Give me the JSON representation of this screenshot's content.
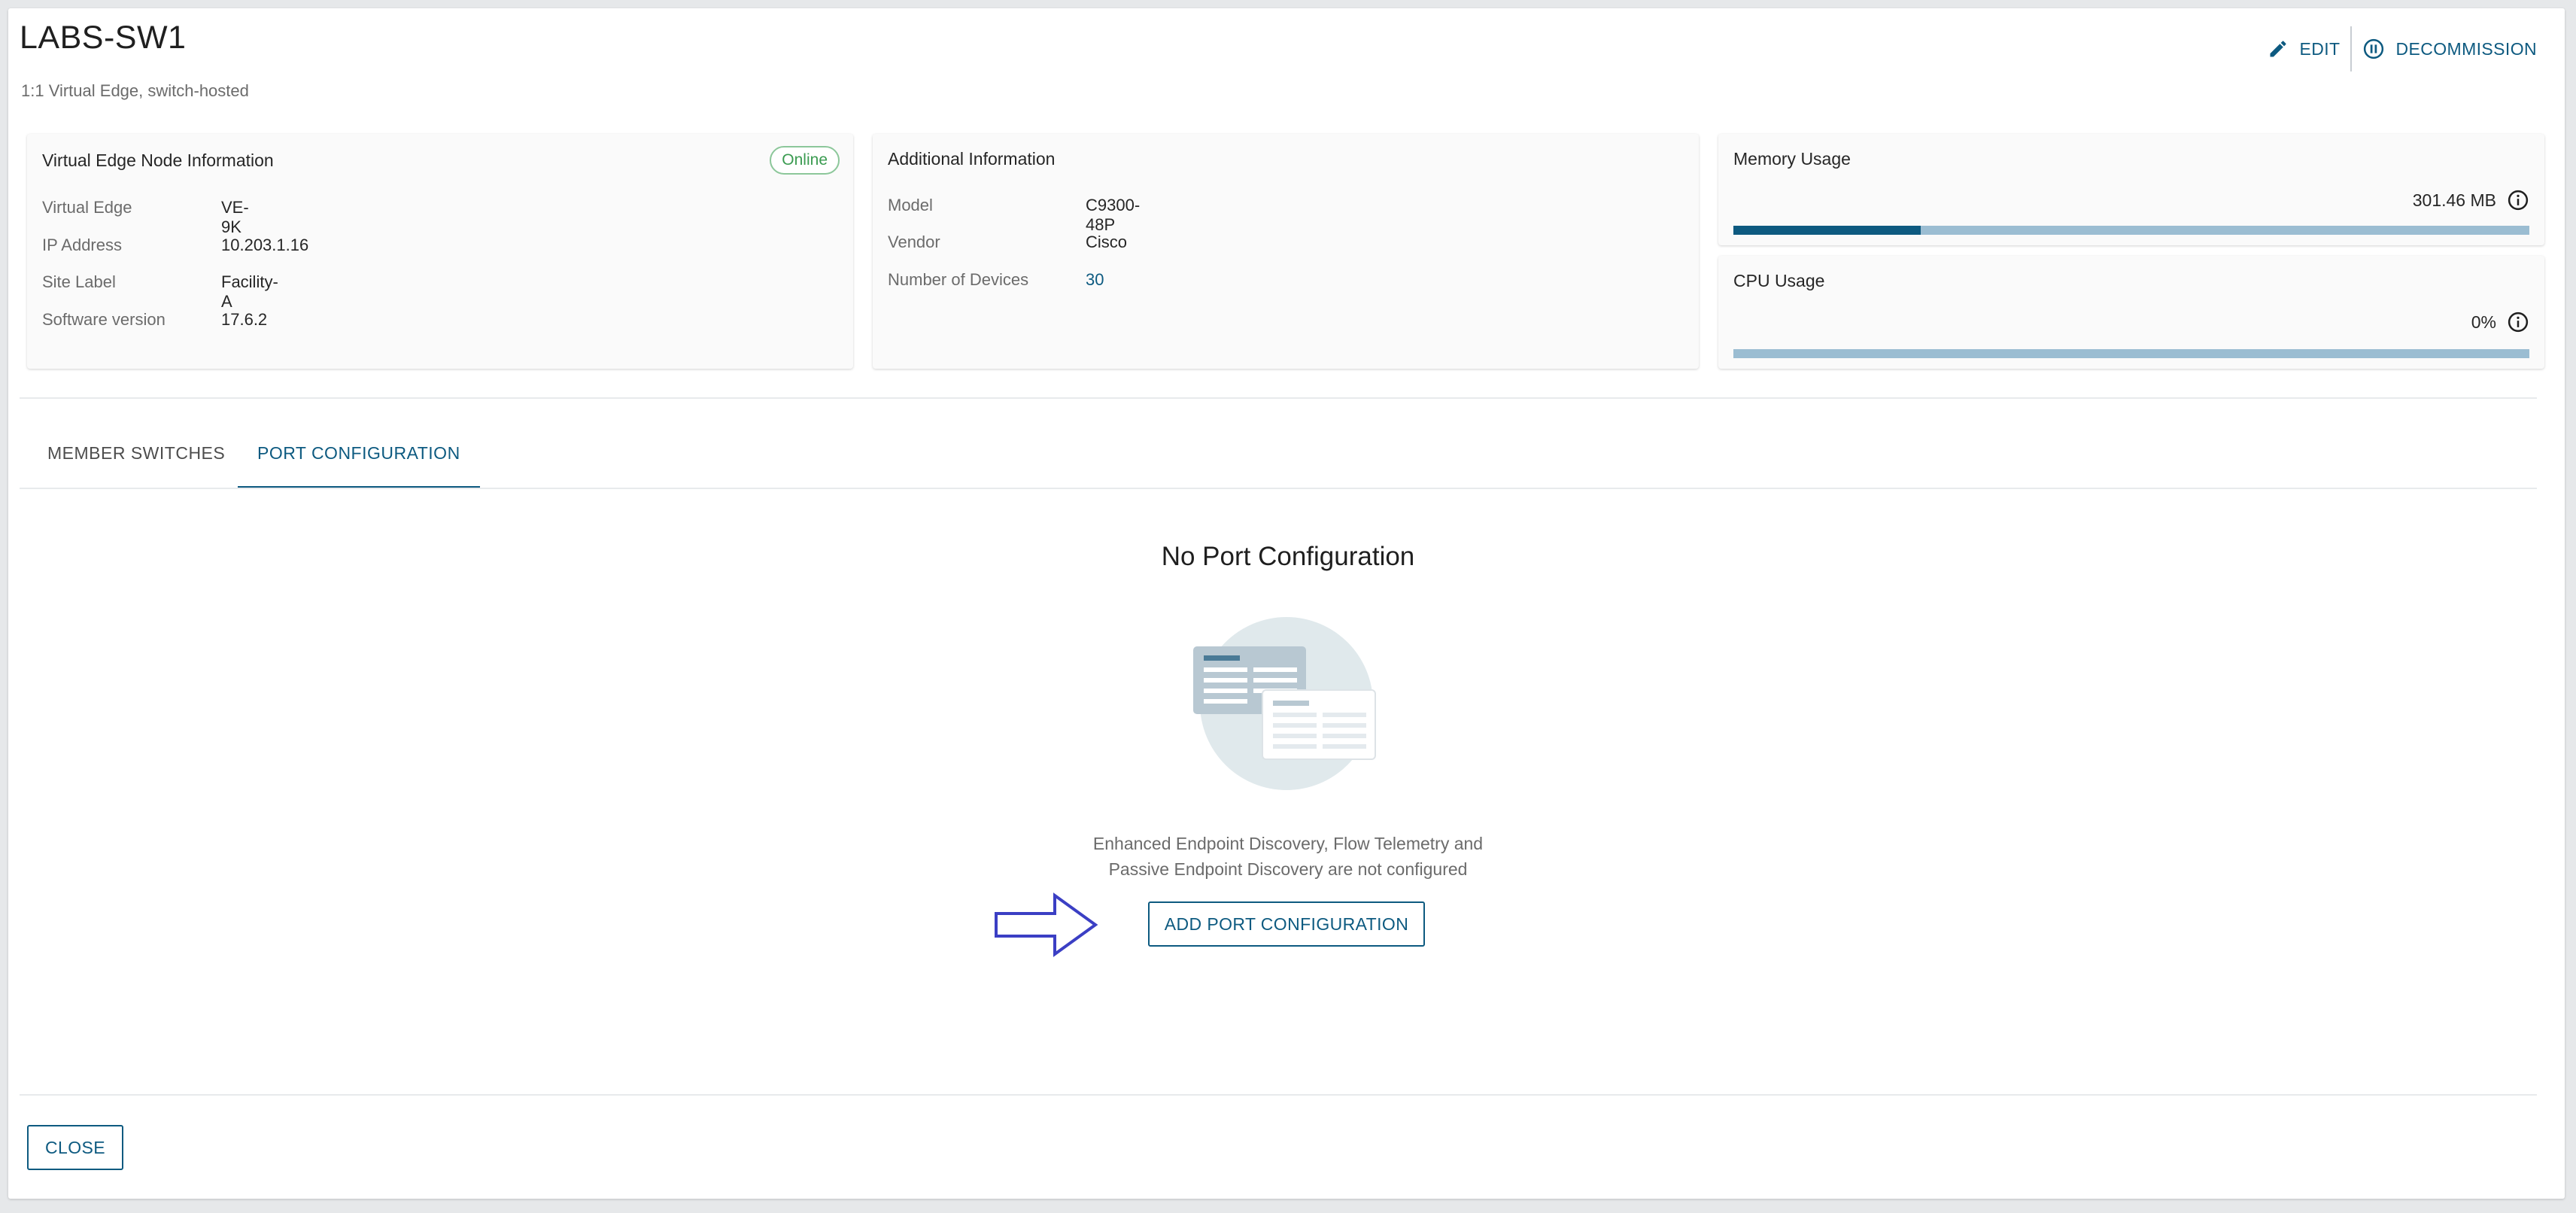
{
  "header": {
    "title": "LABS-SW1",
    "subtitle": "1:1 Virtual Edge, switch-hosted",
    "edit_label": "EDIT",
    "decommission_label": "DECOMMISSION"
  },
  "node_info": {
    "title": "Virtual Edge Node Information",
    "status": "Online",
    "rows": [
      {
        "label": "Virtual Edge",
        "value": "VE-9K"
      },
      {
        "label": "IP Address",
        "value": "10.203.1.16"
      },
      {
        "label": "Site Label",
        "value": "Facility-A"
      },
      {
        "label": "Software version",
        "value": "17.6.2"
      }
    ]
  },
  "additional_info": {
    "title": "Additional Information",
    "rows": [
      {
        "label": "Model",
        "value": "C9300-48P"
      },
      {
        "label": "Vendor",
        "value": "Cisco"
      },
      {
        "label": "Number of Devices",
        "value": "30"
      }
    ]
  },
  "memory": {
    "title": "Memory Usage",
    "value": "301.46 MB",
    "fill_fraction": 0.235
  },
  "cpu": {
    "title": "CPU Usage",
    "value": "0%",
    "fill_fraction": 0
  },
  "tabs": [
    {
      "label": "MEMBER SWITCHES",
      "active": false
    },
    {
      "label": "PORT CONFIGURATION",
      "active": true
    }
  ],
  "empty_state": {
    "title": "No Port Configuration",
    "description_line1": "Enhanced Endpoint Discovery, Flow Telemetry and",
    "description_line2": "Passive Endpoint Discovery are not configured",
    "button_label": "ADD PORT CONFIGURATION"
  },
  "footer": {
    "close_label": "CLOSE"
  },
  "colors": {
    "accent": "#0d5a80",
    "bar_track": "#9bbdd2",
    "online_green": "#3a9b50",
    "arrow_blue": "#3b3fc4"
  },
  "icons": [
    "pencil-icon",
    "pause-circle-icon",
    "info-icon",
    "arrow-right-icon",
    "empty-config-illustration"
  ]
}
